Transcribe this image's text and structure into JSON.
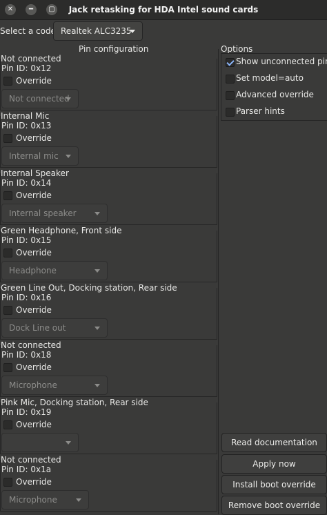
{
  "window": {
    "title": "Jack retasking for HDA Intel sound cards"
  },
  "codec": {
    "label": "Select a codec:",
    "value": "Realtek ALC3235"
  },
  "pin_configuration": {
    "title": "Pin configuration"
  },
  "pins": [
    {
      "name": "Not connected",
      "id": "Pin ID: 0x12",
      "override": "Override",
      "value": "Not connected"
    },
    {
      "name": "Internal Mic",
      "id": "Pin ID: 0x13",
      "override": "Override",
      "value": "Internal mic"
    },
    {
      "name": "Internal Speaker",
      "id": "Pin ID: 0x14",
      "override": "Override",
      "value": "Internal speaker"
    },
    {
      "name": "Green Headphone, Front side",
      "id": "Pin ID: 0x15",
      "override": "Override",
      "value": "Headphone"
    },
    {
      "name": "Green Line Out, Docking station, Rear side",
      "id": "Pin ID: 0x16",
      "override": "Override",
      "value": "Dock Line out"
    },
    {
      "name": "Not connected",
      "id": "Pin ID: 0x18",
      "override": "Override",
      "value": "Microphone"
    },
    {
      "name": "Pink Mic, Docking station, Rear side",
      "id": "Pin ID: 0x19",
      "override": "Override",
      "value": ""
    },
    {
      "name": "Not connected",
      "id": "Pin ID: 0x1a",
      "override": "Override",
      "value": "Microphone"
    }
  ],
  "options": {
    "title": "Options",
    "items": [
      {
        "label": "Show unconnected pins",
        "checked": true
      },
      {
        "label": "Set model=auto",
        "checked": false
      },
      {
        "label": "Advanced override",
        "checked": false
      },
      {
        "label": "Parser hints",
        "checked": false
      }
    ]
  },
  "buttons": {
    "read_docs": "Read documentation",
    "apply": "Apply now",
    "install": "Install boot override",
    "remove": "Remove boot override"
  },
  "colors": {
    "window_bg": "#3a3a39",
    "titlebar_bg": "#2c2c2b",
    "checkmark": "#8ab4f8"
  }
}
